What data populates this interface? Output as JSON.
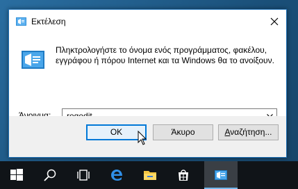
{
  "window": {
    "title": "Εκτέλεση",
    "close_icon": "close-icon"
  },
  "dialog": {
    "description": "Πληκτρολογήστε το όνομα ενός προγράμματος, φακέλου, εγγράφου ή πόρου Internet και τα Windows θα το ανοίξουν.",
    "open_label_prefix": "Ά",
    "open_label_underlined": "ν",
    "open_label_suffix": "οιγμα:",
    "open_value": "regedit"
  },
  "buttons": {
    "ok": "OK",
    "cancel": "Άκυρο",
    "browse_underlined": "Α",
    "browse_rest": "ναζήτηση..."
  },
  "taskbar": {
    "items": [
      "start-icon",
      "search-icon",
      "task-view-icon",
      "edge-icon",
      "file-explorer-icon",
      "store-icon",
      "run-icon"
    ]
  },
  "colors": {
    "accent": "#0078d7",
    "taskbar": "#101418"
  }
}
